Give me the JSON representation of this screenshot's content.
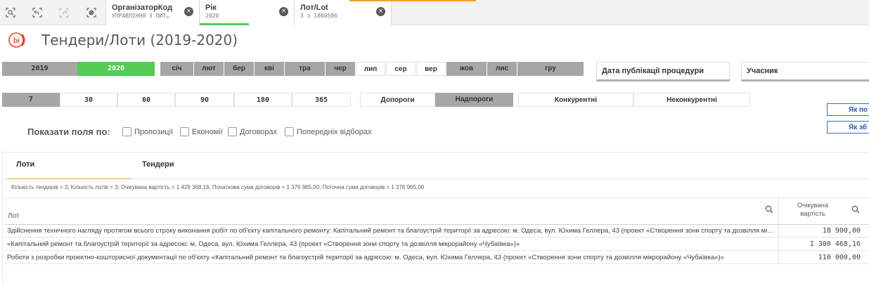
{
  "toolbar": {
    "icons": [
      "smart-search-icon",
      "step-back-icon",
      "step-forward-icon",
      "clear-selections-icon"
    ]
  },
  "selections": [
    {
      "title": "ОрганізаторКод",
      "value": "УПРАВЛІННЯ З ПИТ…",
      "close": "×"
    },
    {
      "title": "Рік",
      "value": "2020",
      "close": "×"
    },
    {
      "title": "Лот/Lot",
      "value": "3 з 1860586",
      "close": "×"
    }
  ],
  "colors": {
    "green": "#52cc52",
    "gray": "#a6a6a6",
    "orange": "#f0a030",
    "link": "#2a5aa6",
    "logo": "#e8432e"
  },
  "logo": {
    "text": "bi"
  },
  "title": "Тендери/Лоти (2019-2020)",
  "years": [
    "2019",
    "2020"
  ],
  "months": [
    "січ",
    "лют",
    "бер",
    "кві",
    "тра",
    "чер",
    "лип",
    "сер",
    "вер",
    "жов",
    "лис",
    "гру"
  ],
  "fields": {
    "publication_date": "Дата публікації процедури",
    "participant": "Учасник"
  },
  "days": [
    "7",
    "30",
    "60",
    "90",
    "180",
    "365"
  ],
  "thresholds": [
    "Допороги",
    "Надпороги"
  ],
  "competition": [
    "Конкурентні",
    "Неконкурентні"
  ],
  "side_buttons": [
    "Як по",
    "Як зб"
  ],
  "show_fields": {
    "label": "Показати поля по:",
    "options": [
      "Пропозиції",
      "Економії",
      "Договорах",
      "Попередніх відборах"
    ]
  },
  "tabs": [
    "Лоти",
    "Тендери"
  ],
  "summary": "Кількість тендерів = 3; Кількість лотів = 3; Очікувана вартість = 1 429 368,16; Початкова сума договорів = 1 376 965,00; Поточна сума договорів = 1 376 965,00",
  "table": {
    "headers": {
      "lot": "Лот",
      "expected_value_l1": "Очікувана",
      "expected_value_l2": "вартість"
    },
    "rows": [
      {
        "lot": "Здійснення технічного нагляду протягом всього строку виконання робіт по об'єкту капітального ремонту: Капітальний ремонт та благоустрій території за адресою: м. Одеса, вул. Юхима Геллера, 43 (проект «Створення зони спорту та дозвілля мікрорайону «Чубаївка»)",
        "value": "18 900,00"
      },
      {
        "lot": "«Капітальний ремонт та благоустрій території за адресою: м. Одеса, вул. Юхима Геллера, 43 (проект «Створення зони спорту та дозвілля мікрорайону «Чубаївка»)»",
        "value": "1 300 468,16"
      },
      {
        "lot": "Роботи з розробки проектно-кошторисної документації по об'єкту «Капітальний ремонт та благоустрій території за адресою: м. Одеса, вул. Юхима Геллера, 43 (проект «Створення зони спорту та дозвілля мікрорайону «Чубаївка»)»",
        "value": "110 000,00"
      }
    ]
  }
}
